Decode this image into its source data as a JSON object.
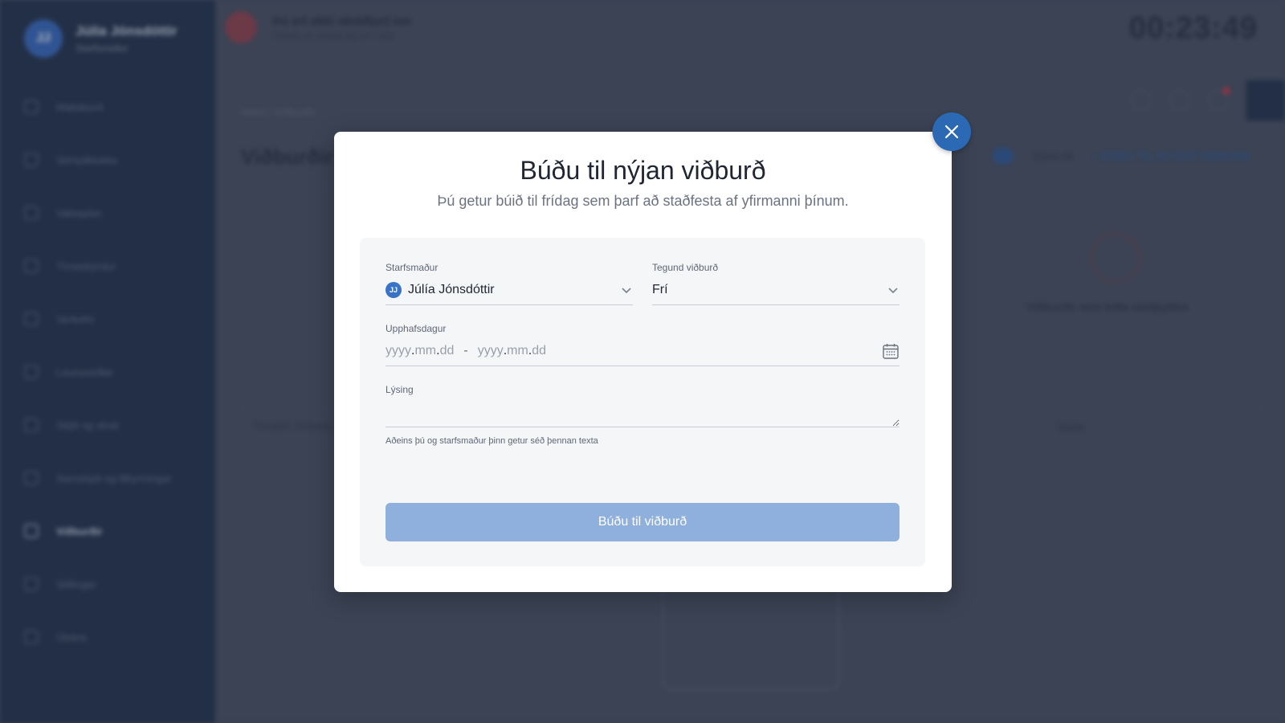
{
  "background": {
    "sidebar": {
      "avatar_initials": "JJ",
      "user_name": "Júlía Jónsdóttir",
      "user_role": "Starfsmaður",
      "items": [
        {
          "label": "Mælaborð"
        },
        {
          "label": "Stimpilklukka"
        },
        {
          "label": "Vaktaplan"
        },
        {
          "label": "Tímaskýrslur"
        },
        {
          "label": "Verkefni"
        },
        {
          "label": "Launaseðlar"
        },
        {
          "label": "Skjöl og skrár"
        },
        {
          "label": "Samskipti og tilkynningar"
        },
        {
          "label": "Viðburðir",
          "active": true
        },
        {
          "label": "Stillingar"
        },
        {
          "label": "Útskrá"
        }
      ]
    },
    "topbar": {
      "alert_title": "Þú ert ekki skráð(ur) inn",
      "alert_sub": "Mundu að stimpla þig inn í dag",
      "clock": "00:23:49"
    },
    "breadcrumb": "Heim / Viðburðir",
    "page_title": "Viðburðir",
    "toggle_label": "Sýna öll",
    "new_event_label": "+ BÚÐU TIL NÝJAN VIÐBURÐ",
    "stat_value": "0",
    "stat_label": "Viðburðir sem bíða samþykkis",
    "filter_label": "Tímabil: Síðustu 30 dagar",
    "filter_right": "Staða"
  },
  "modal": {
    "title": "Búðu til nýjan viðburð",
    "subtitle": "Þú getur búið til frídag sem þarf að staðfesta af yfirmanni þínum.",
    "employee": {
      "label": "Starfsmaður",
      "initials": "JJ",
      "value": "Júlía Jónsdóttir"
    },
    "event_type": {
      "label": "Tegund viðburð",
      "value": "Frí"
    },
    "start_date": {
      "label": "Upphafsdagur",
      "from": {
        "yyyy": "yyyy",
        "mm": "mm",
        "dd": "dd"
      },
      "separator": "-",
      "to": {
        "yyyy": "yyyy",
        "mm": "mm",
        "dd": "dd"
      }
    },
    "description": {
      "label": "Lýsing",
      "value": "",
      "helper": "Aðeins þú og starfsmaður þinn getur séð þennan texta"
    },
    "submit_label": "Búðu til viðburð",
    "colors": {
      "accent": "#2c69b5",
      "submit_disabled": "#8fb0dc"
    }
  }
}
